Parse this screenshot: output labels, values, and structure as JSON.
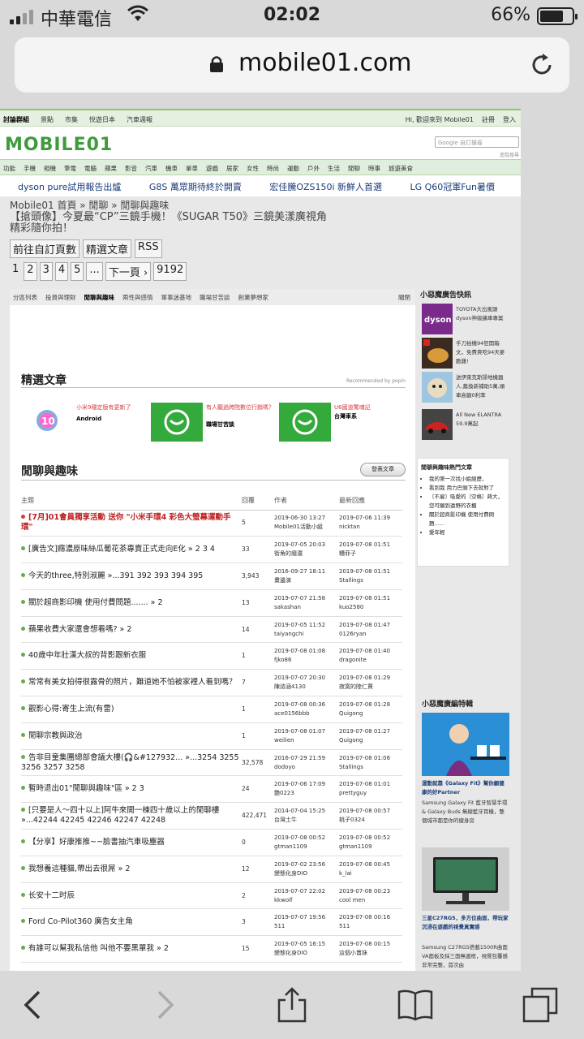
{
  "status": {
    "carrier": "中華電信",
    "time": "02:02",
    "battery": "66%"
  },
  "browser": {
    "domain": "mobile01.com"
  },
  "site": {
    "top_nav": [
      "討論群組",
      "景點",
      "市集",
      "悅遊日本",
      "汽車週報"
    ],
    "top_right": [
      "Hi, 歡迎來到 Mobile01",
      "註冊",
      "登入"
    ],
    "logo": "MOBILE01",
    "search_placeholder": "Google 自訂搜尋",
    "adv_search": "進階搜尋",
    "categories": [
      "功能",
      "手機",
      "相機",
      "筆電",
      "電腦",
      "蘋果",
      "影音",
      "汽車",
      "機車",
      "單車",
      "遊戲",
      "居家",
      "女性",
      "時尚",
      "運動",
      "戶外",
      "生活",
      "閒聊",
      "時事",
      "旅遊美食"
    ],
    "promos": [
      "dyson pure試用報告出爐",
      "G8S 萬眾期待終於開賣",
      "宏佳騰OZS150i 新鮮人首選",
      "LG Q60冠軍Fun暑價"
    ]
  },
  "breadcrumb": "Mobile01 首頁 » 閒聊 » 閒聊與趣味",
  "notice": {
    "line1": "【搶頭像】今夏最“CP”三鏡手機！《SUGAR T50》三鏡美漾廣視角",
    "line2": "精彩隨你拍！"
  },
  "actions": [
    "前往自訂頁數",
    "精選文章",
    "RSS"
  ],
  "pager": [
    "1",
    "2",
    "3",
    "4",
    "5",
    "...",
    "下一頁 ›",
    "9192"
  ],
  "sub_tabs": {
    "items": [
      "分區列表",
      "投資與理財",
      "閒聊與趣味",
      "兩性與感情",
      "軍事迷基地",
      "職場甘苦談",
      "創業夢想家"
    ],
    "close": "關閉"
  },
  "featured": {
    "title": "精選文章",
    "recommended": "Recommended by popin",
    "items": [
      {
        "title": "小米9穩定版有更新了",
        "source": "Android"
      },
      {
        "title": "有人聽過跨院數位行銷嗎？",
        "source": "職場甘苦談"
      },
      {
        "title": "U6國道驚魂記",
        "source": "台灣車系"
      }
    ]
  },
  "forum": {
    "title": "閒聊與趣味",
    "post_button": "發表文章",
    "columns": [
      "主題",
      "回覆",
      "作者",
      "最新回應"
    ],
    "rows": [
      {
        "topic": "[7月]01會員獨享活動 送你 \"小米手環4 彩色大螢幕運動手環\"",
        "replies": "5",
        "a_date": "2019-06-30 13:27",
        "author": "Mobile01活動小組",
        "l_date": "2019-07-06 11:39",
        "last": "nicktan",
        "pinned": true
      },
      {
        "topic": "[廣告文]癮濃原味絲瓜葡花茶專賣正式走向E化 » 2 3 4",
        "replies": "33",
        "a_date": "2019-07-05 20:03",
        "author": "街角的癮濃",
        "l_date": "2019-07-08 01:51",
        "last": "糟菲子"
      },
      {
        "topic": "今天的three,特別淑麗 »...391 392 393 394 395",
        "replies": "3,943",
        "a_date": "2016-09-27 18:11",
        "author": "畫邊演",
        "l_date": "2019-07-08 01:51",
        "last": "Stallings"
      },
      {
        "topic": "關於超商影印機 使用付費問題....... » 2",
        "replies": "13",
        "a_date": "2019-07-07 21:58",
        "author": "sakashan",
        "l_date": "2019-07-08 01:51",
        "last": "kuo2580"
      },
      {
        "topic": "蘋果收費大家還會想看嗎? » 2",
        "replies": "14",
        "a_date": "2019-07-05 11:52",
        "author": "taiyangchi",
        "l_date": "2019-07-08 01:47",
        "last": "0126ryan"
      },
      {
        "topic": "40歲中年壯漢大叔的背影跟新衣服",
        "replies": "1",
        "a_date": "2019-07-08 01:08",
        "author": "fjko86",
        "l_date": "2019-07-08 01:40",
        "last": "dragonite"
      },
      {
        "topic": "常常有美女拍得很露骨的照片，難道她不怕被家裡人看到嗎？",
        "replies": "7",
        "a_date": "2019-07-07 20:30",
        "author": "陳諮涵4130",
        "l_date": "2019-07-08 01:29",
        "last": "寂寞的陸仁賈"
      },
      {
        "topic": "觀影心得:寄生上流(有雷)",
        "replies": "1",
        "a_date": "2019-07-08 00:36",
        "author": "ace0156bbb",
        "l_date": "2019-07-08 01:28",
        "last": "Quigong"
      },
      {
        "topic": "閒聊宗教與政治",
        "replies": "1",
        "a_date": "2019-07-08 01:07",
        "author": "weilien",
        "l_date": "2019-07-08 01:27",
        "last": "Quigong"
      },
      {
        "topic": "告非目童集團總部會議大樓(🎧&#127932... »...3254 3255 3256 3257 3258",
        "replies": "32,578",
        "a_date": "2016-07-29 21:59",
        "author": "dodoyo",
        "l_date": "2019-07-08 01:06",
        "last": "Stallings"
      },
      {
        "topic": "暫時退出01\"閒聊與趣味\"區 » 2 3",
        "replies": "24",
        "a_date": "2019-07-06 17:09",
        "author": "艷0223",
        "l_date": "2019-07-08 01:01",
        "last": "prettyguy"
      },
      {
        "topic": "[只要是人〜四十以上]阿牛來開一棟四十歲以上的閒聊樓 »...42244 42245 42246 42247 42248",
        "replies": "422,471",
        "a_date": "2014-07-04 15:25",
        "author": "台灣土牛",
        "l_date": "2019-07-08 00:57",
        "last": "桃子0324"
      },
      {
        "topic": "【分享】好康推推~~臉書抽汽車吸塵器",
        "replies": "0",
        "a_date": "2019-07-08 00:52",
        "author": "gtman1109",
        "l_date": "2019-07-08 00:52",
        "last": "gtman1109"
      },
      {
        "topic": "我想養這種貓,帶出去很屌 » 2",
        "replies": "12",
        "a_date": "2019-07-02 23:56",
        "author": "變態化身DIO",
        "l_date": "2019-07-08 00:45",
        "last": "k_lai"
      },
      {
        "topic": "长安十二时辰",
        "replies": "2",
        "a_date": "2019-07-07 22:02",
        "author": "kkwolf",
        "l_date": "2019-07-08 00:23",
        "last": "cool men"
      },
      {
        "topic": "Ford Co-Pilot360 廣告女主角",
        "replies": "3",
        "a_date": "2019-07-07 19:56",
        "author": "511",
        "l_date": "2019-07-08 00:16",
        "last": "511"
      },
      {
        "topic": "有誰可以幫我私信他 叫他不要黑單我 » 2",
        "replies": "15",
        "a_date": "2019-07-05 16:15",
        "author": "變態化身DIO",
        "l_date": "2019-07-08 00:15",
        "last": "這個小賣妹"
      }
    ]
  },
  "sidebar": {
    "ad_title": "小惡魔廣告快訊",
    "ads": [
      {
        "text": "TOYOTA大出風頭dyson神級擴車專案",
        "img": "dyson"
      },
      {
        "text": "手刀拍機94狂開箱文，免費爽吃94天麥脆雞!",
        "img": "chicken"
      },
      {
        "text": "送伊萊克斯掃地機器人,舊換新補助5萬,順車高額0利率",
        "img": "dog"
      },
      {
        "text": "All New ELANTRA 59.9萬起",
        "img": "car"
      }
    ],
    "hot_title": "閒聊與趣味熱門文章",
    "hot": [
      "我的第一次找小姐經歷，",
      "看到我 用力巴頭下去就對了",
      "〔不雇〕吸愛的〔空格〕蒔大，您可願到遠野的衣櫃",
      "關於超商影印機 使用付費問題......",
      "愛年輕"
    ],
    "special_title": "小惡魔廣編特輯",
    "specials": [
      {
        "title": "運動就靠《Galaxy Fit》幫你顧健康的好Partner",
        "desc": "Samsung Galaxy Fit 藍牙智慧手環 & Galaxy Buds 無線藍牙耳機，整個城市都是你的健身房"
      },
      {
        "title": "三星C27RG5，多方位曲面，帶玩家沉浸在遊戲的視覺真實感",
        "desc": "Samsung C27RG5搭載1500R曲面VA面板及採三面無邊框，視覺包覆感非常完整，首次由"
      }
    ]
  }
}
